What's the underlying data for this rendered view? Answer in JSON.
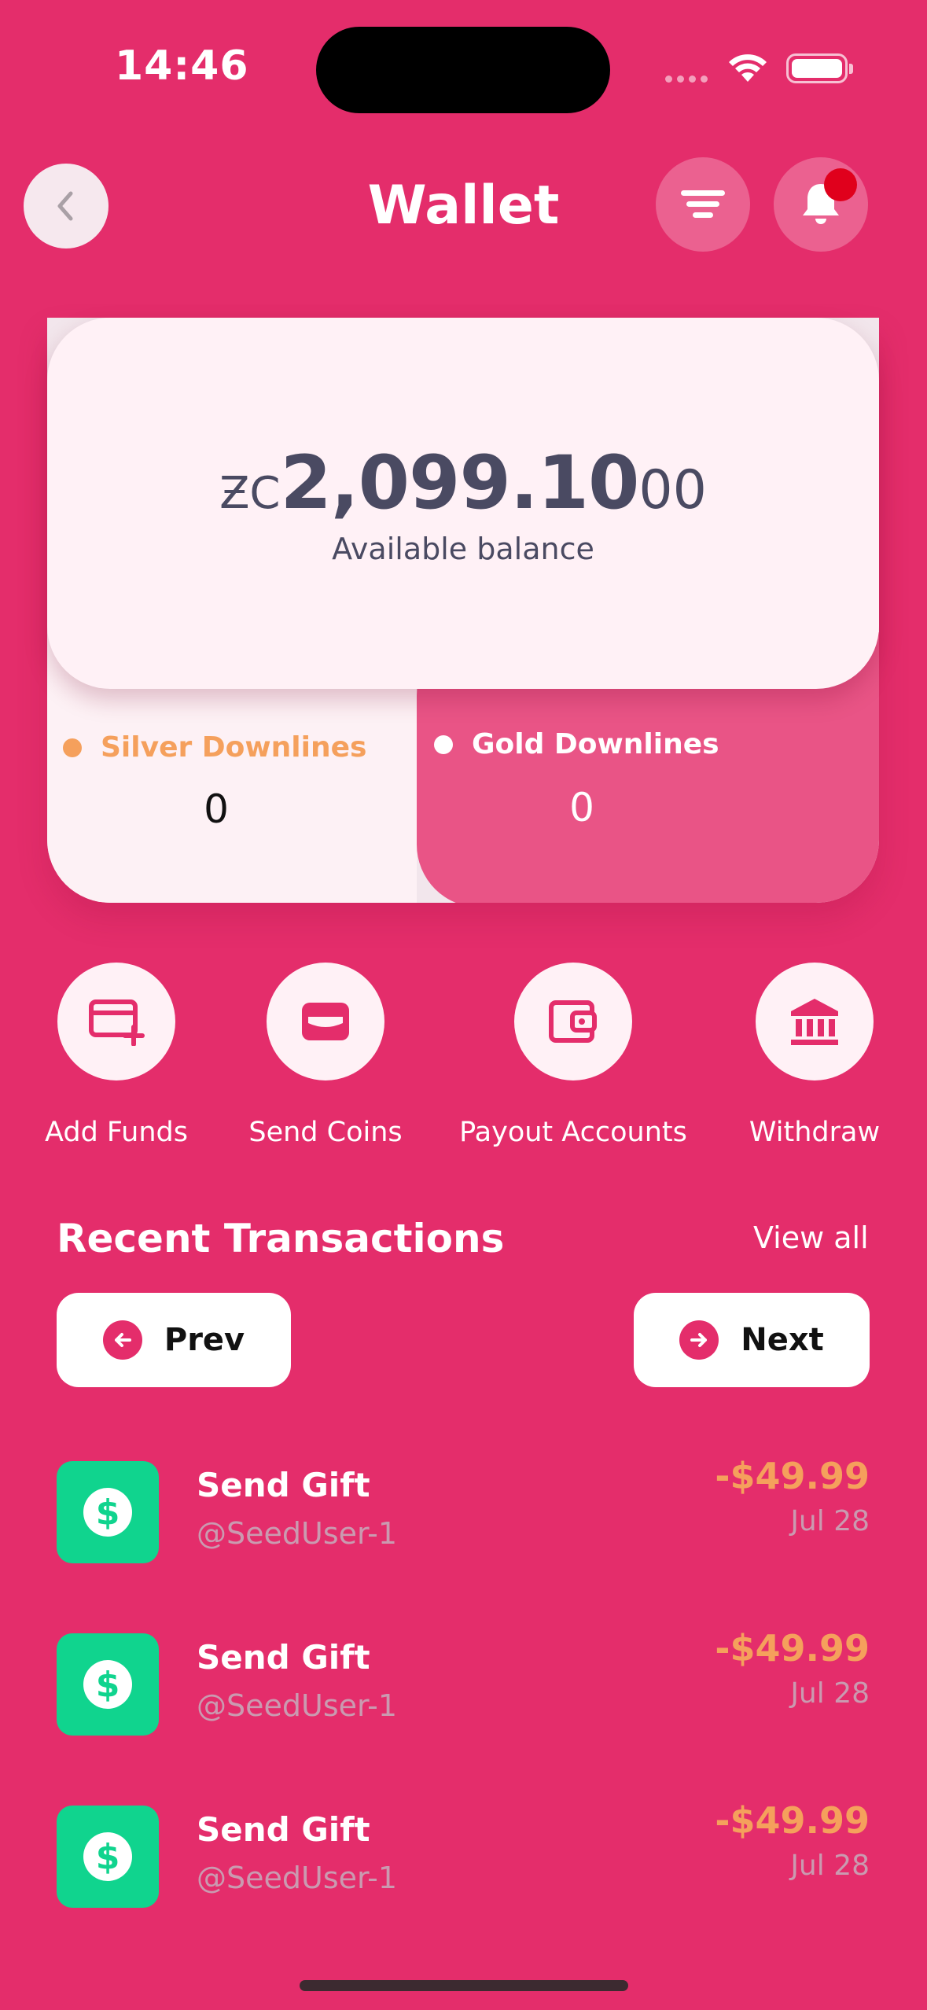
{
  "status_bar": {
    "time": "14:46"
  },
  "header": {
    "title": "Wallet"
  },
  "balance": {
    "currency_symbol": "ƵC",
    "amount_main": "2,099.10",
    "amount_decimals": "00",
    "label": "Available balance"
  },
  "downlines": {
    "silver": {
      "label": "Silver Downlines",
      "value": "0",
      "color": "#F5A05C"
    },
    "gold": {
      "label": "Gold Downlines",
      "value": "0",
      "color": "#E95486"
    }
  },
  "actions": [
    {
      "label": "Add Funds",
      "icon": "add-card-icon"
    },
    {
      "label": "Send Coins",
      "icon": "wallet-card-icon"
    },
    {
      "label": "Payout Accounts",
      "icon": "wallet-icon"
    },
    {
      "label": "Withdraw",
      "icon": "bank-icon"
    }
  ],
  "transactions": {
    "title": "Recent Transactions",
    "view_all": "View all",
    "prev_label": "Prev",
    "next_label": "Next",
    "items": [
      {
        "title": "Send Gift",
        "user": "@SeedUser-1",
        "amount": "-$49.99",
        "date": "Jul 28"
      },
      {
        "title": "Send Gift",
        "user": "@SeedUser-1",
        "amount": "-$49.99",
        "date": "Jul 28"
      },
      {
        "title": "Send Gift",
        "user": "@SeedUser-1",
        "amount": "-$49.99",
        "date": "Jul 28"
      }
    ]
  },
  "colors": {
    "background": "#E42D6B",
    "accent_orange": "#F5A05C",
    "tx_icon_green": "#10D48E",
    "notification_badge": "#E0001C"
  }
}
